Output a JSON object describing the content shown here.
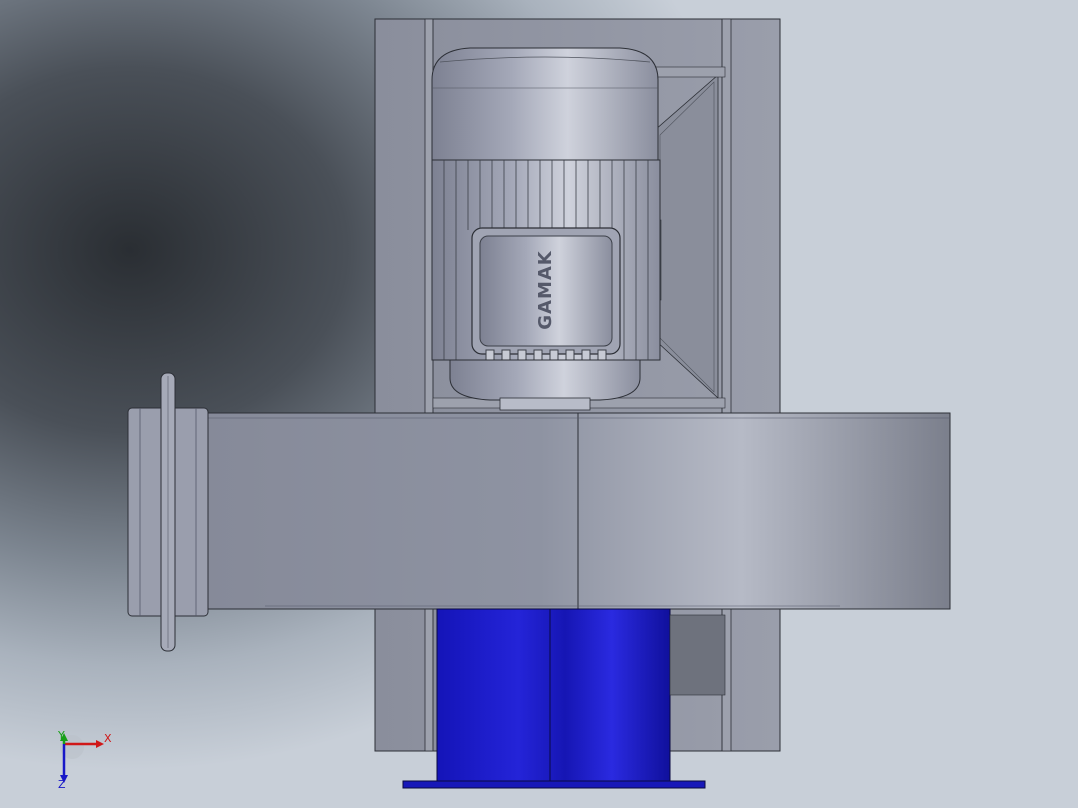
{
  "viewport": {
    "background": "#8a939d",
    "motor": {
      "brand": "GAMAK",
      "color": "#a9adbb"
    },
    "housing_color": "#9a9eac",
    "base_color": "#1c1cc4",
    "triad": {
      "x_label": "X",
      "y_label": "Y",
      "z_label": "Z",
      "x_color": "#d01818",
      "y_color": "#18a018",
      "z_color": "#1818c8"
    }
  }
}
